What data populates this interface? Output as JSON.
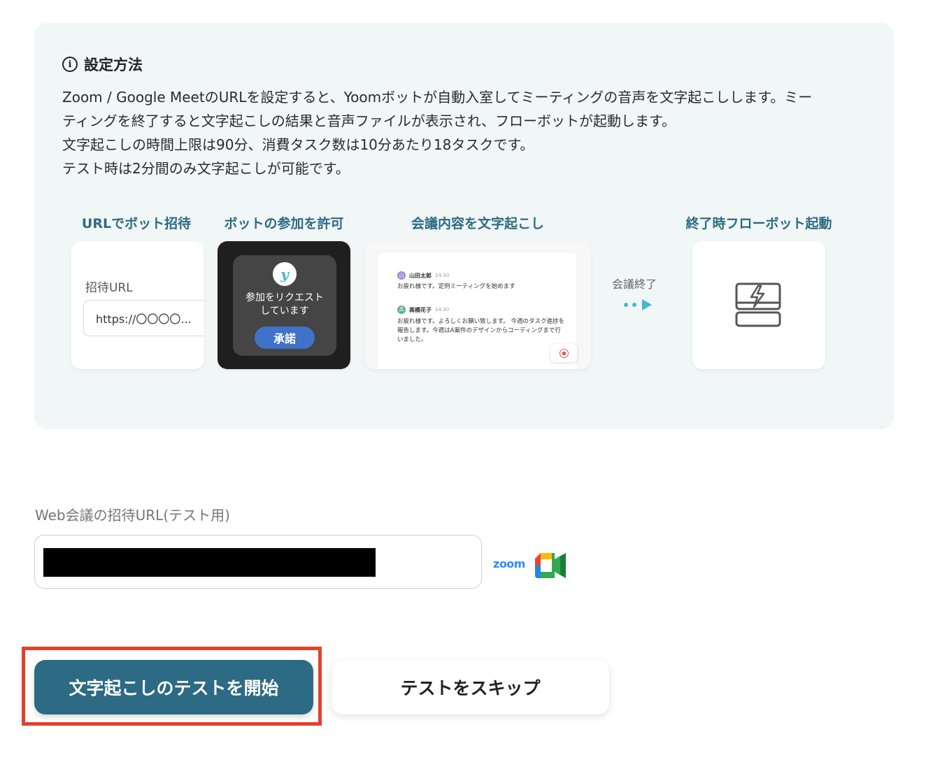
{
  "setup": {
    "title": "設定方法",
    "info_icon": "i",
    "lines": [
      "Zoom / Google MeetのURLを設定すると、Yoomボットが自動入室してミーティングの音声を文字起こしします。ミー",
      "ティングを終了すると文字起こしの結果と音声ファイルが表示され、フローボットが起動します。",
      "文字起こしの時間上限は90分、消費タスク数は10分あたり18タスクです。",
      "テスト時は2分間のみ文字起こしが可能です。"
    ]
  },
  "steps": {
    "invite": {
      "label": "URLでボット招待",
      "field_label": "招待URL",
      "field_value": "https://〇〇〇〇..."
    },
    "permit": {
      "label": "ボットの参加を許可",
      "logo": "y",
      "message_line1": "参加をリクエスト",
      "message_line2": "しています",
      "accept_button": "承諾"
    },
    "transcribe": {
      "label": "会議内容を文字起こし",
      "entries": [
        {
          "avatar": "山",
          "name": "山田太郎",
          "time": "14:30",
          "text": "お疲れ様です。定例ミーティングを始めます"
        },
        {
          "avatar": "高",
          "name": "高橋花子",
          "time": "14:30",
          "text": "お疲れ様です。よろしくお願い致します。 今週のタスク進捗を報告します。今週はA案件のデザインからコーディングまで行いました。"
        }
      ]
    },
    "connector": {
      "label": "会議終了"
    },
    "flowbot": {
      "label": "終了時フローボット起動"
    }
  },
  "url_field": {
    "label": "Web会議の招待URL(テスト用)",
    "value": "",
    "zoom_logo": "zoom"
  },
  "actions": {
    "start_label": "文字起こしのテストを開始",
    "skip_label": "テストをスキップ"
  },
  "colors": {
    "accent": "#2d6a83",
    "highlight": "#e5402a",
    "panel_bg": "#f1f6f6"
  }
}
